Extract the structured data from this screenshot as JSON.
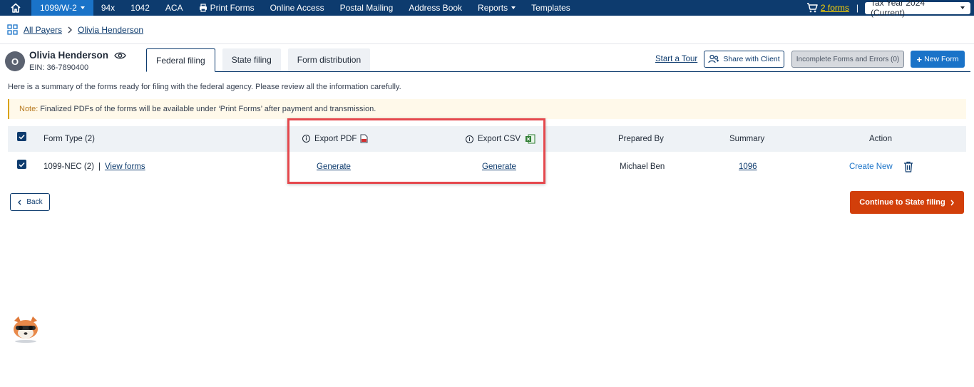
{
  "nav": {
    "items": [
      "1099/W-2",
      "94x",
      "1042",
      "ACA",
      "Print Forms",
      "Online Access",
      "Postal Mailing",
      "Address Book",
      "Reports",
      "Templates"
    ],
    "cart_label": "2 forms",
    "separator": "|",
    "tax_year": "Tax Year 2024 (Current)"
  },
  "breadcrumb": {
    "root": "All Payers",
    "current": "Olivia Henderson"
  },
  "payer": {
    "initial": "O",
    "name": "Olivia Henderson",
    "ein": "EIN: 36-7890400"
  },
  "tabs": [
    "Federal filing",
    "State filing",
    "Form distribution"
  ],
  "actions": {
    "tour": "Start a Tour",
    "share": "Share with Client",
    "incomplete": "Incomplete Forms and Errors (0)",
    "new_form": "New Form"
  },
  "summary_text": "Here is a summary of the forms ready for filing with the federal agency. Please review all the information carefully.",
  "note": {
    "label": "Note:",
    "text": "Finalized PDFs of the forms will be available under ‘Print Forms’ after payment and transmission."
  },
  "table": {
    "headers": {
      "form_type": "Form Type  (2)",
      "export_pdf": "Export PDF",
      "export_csv": "Export CSV",
      "prepared_by": "Prepared By",
      "summary": "Summary",
      "action": "Action"
    },
    "row": {
      "form_type": "1099-NEC (2)",
      "sep": "|",
      "view_forms": "View forms",
      "pdf_action": "Generate",
      "csv_action": "Generate",
      "prepared_by": "Michael Ben",
      "summary": "1096",
      "create_new": "Create New"
    }
  },
  "buttons": {
    "back": "Back",
    "continue": "Continue to State filing"
  },
  "colors": {
    "nav_bg": "#0d3b6e",
    "active_nav": "#1a73c8",
    "primary": "#1a73c8",
    "continue": "#d23f0a",
    "highlight_border": "#e5484d"
  }
}
